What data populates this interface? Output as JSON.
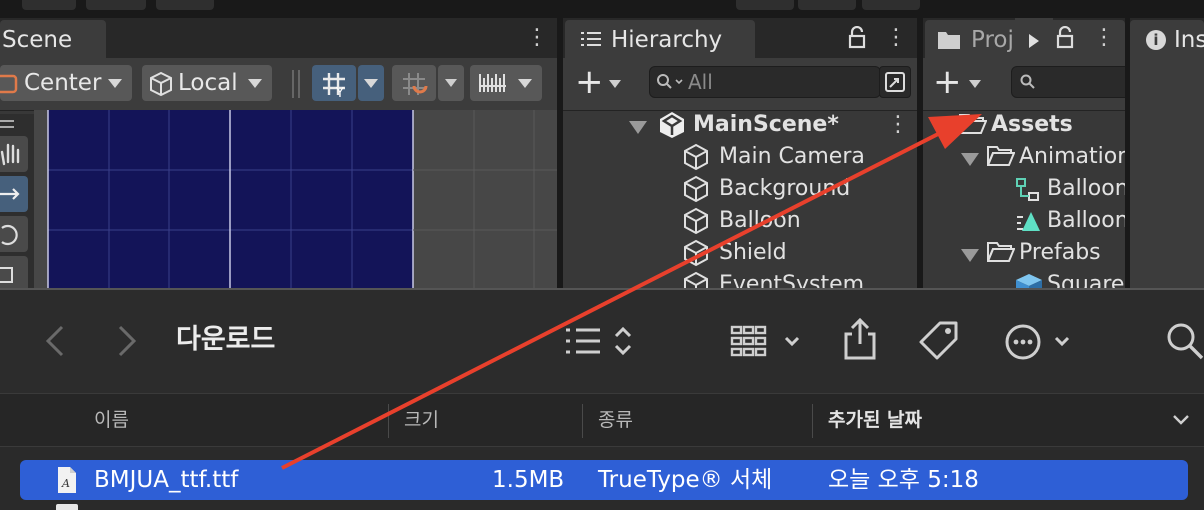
{
  "scene": {
    "tab_label": "Scene",
    "pivot_label": "Center",
    "space_label": "Local"
  },
  "hierarchy": {
    "tab_label": "Hierarchy",
    "search_placeholder": "All",
    "scene_name": "MainScene*",
    "items": [
      "Main Camera",
      "Background",
      "Balloon",
      "Shield",
      "EventSystem"
    ]
  },
  "project": {
    "tab_label": "Proj",
    "items": [
      {
        "label": "Assets",
        "indent": 0
      },
      {
        "label": "Animation",
        "indent": 1
      },
      {
        "label": "Balloon",
        "indent": 2
      },
      {
        "label": "Balloon",
        "indent": 2
      },
      {
        "label": "Prefabs",
        "indent": 1
      },
      {
        "label": "Square",
        "indent": 2
      }
    ]
  },
  "inspector": {
    "tab_label": "Ins"
  },
  "finder": {
    "title": "다운로드",
    "columns": {
      "name": "이름",
      "size": "크기",
      "kind": "종류",
      "date": "추가된 날짜"
    },
    "files": [
      {
        "name": "BMJUA_ttf.ttf",
        "size": "1.5MB",
        "kind": "TrueType® 서체",
        "date": "오늘 오후 5:18",
        "selected": true
      }
    ]
  },
  "annotation": {
    "arrow_color": "#e8402c"
  }
}
